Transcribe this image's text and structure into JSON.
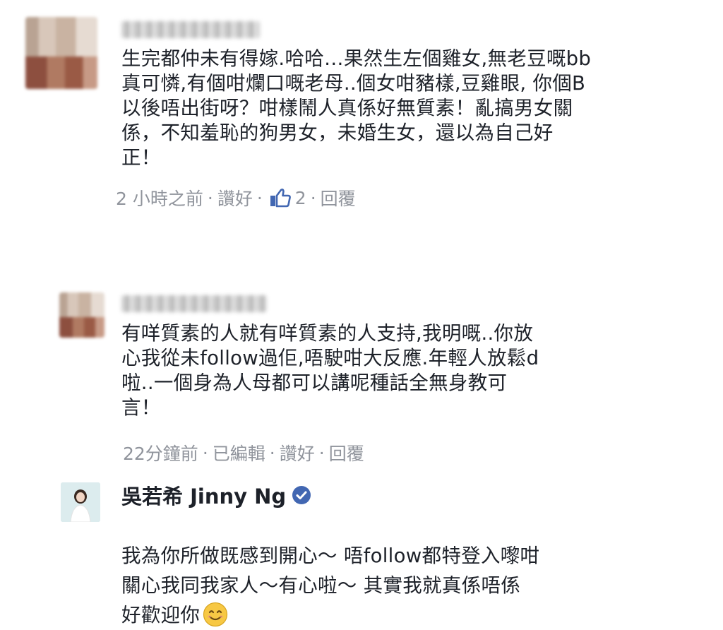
{
  "comments": [
    {
      "author": "",
      "text": "生完都仲未有得嫁.哈哈…果然生左個雞女,無老豆嘅bb\n真可憐,有個咁爛口嘅老母..個女咁豬樣,豆雞眼, 你個B\n以後唔出街呀？咁樣鬧人真係好無質素！亂搞男女關\n係，不知羞恥的狗男女，未婚生女，還以為自己好\n正！",
      "time": "2 小時之前",
      "like_label": "讚好",
      "like_count": "2",
      "reply_label": "回覆"
    },
    {
      "author": "",
      "text": "有咩質素的人就有咩質素的人支持,我明嘅..你放\n心我從未follow過佢,唔駛咁大反應.年輕人放鬆d\n啦..一個身為人母都可以講呢種話全無身教可\n言！",
      "time": "22分鐘前",
      "edited_label": "已編輯",
      "like_label": "讚好",
      "reply_label": "回覆"
    },
    {
      "author": "吳若希 Jinny Ng",
      "verified": true,
      "text": "我為你所做既感到開心～ 唔follow都特登入嚟咁\n關心我同我家人～有心啦～ 其實我就真係唔係\n好歡迎你",
      "emoji": "smile-emoji"
    }
  ],
  "colors": {
    "text": "#1d2129",
    "meta": "#90949c",
    "like_blue": "#4267b2",
    "verified_blue": "#4267b2",
    "emoji_yellow": "#f7c844"
  }
}
